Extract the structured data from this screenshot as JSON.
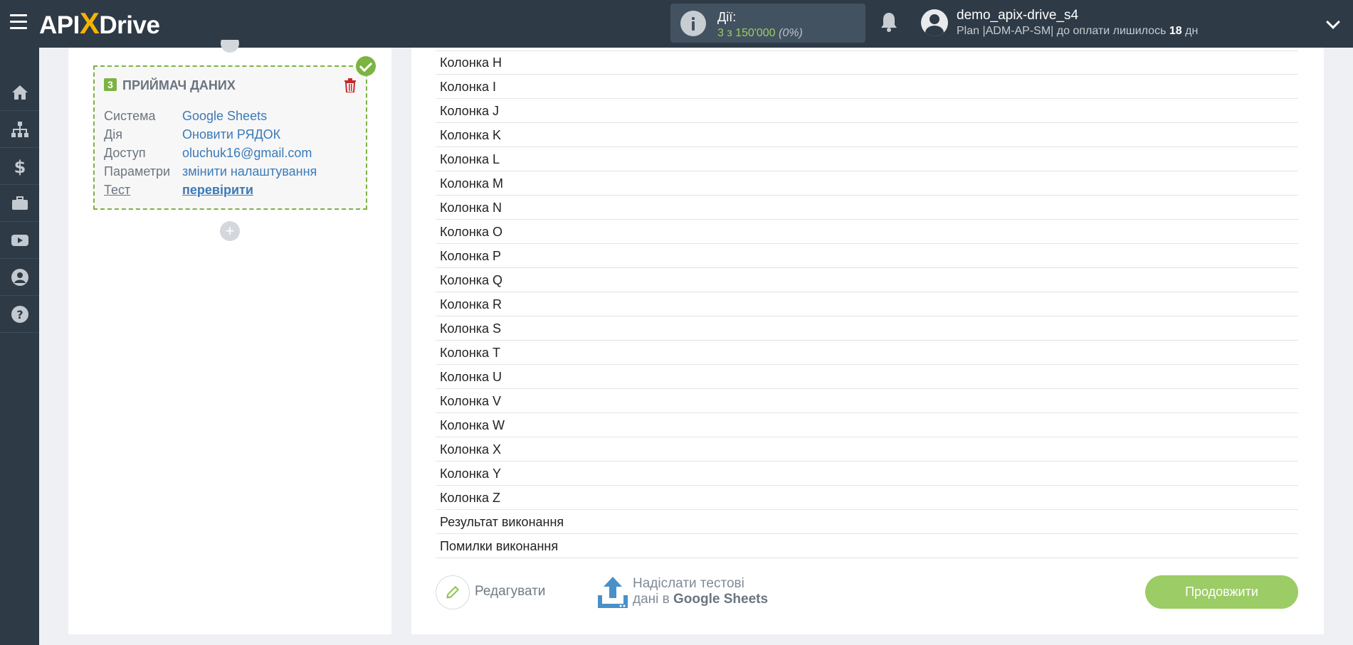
{
  "header": {
    "logo": {
      "prefix": "API",
      "x": "X",
      "suffix": "Drive"
    },
    "actions_label": "Дії:",
    "actions_count": "3 з 150'000",
    "actions_percent": "(0%)",
    "user_name": "demo_apix-drive_s4",
    "plan_text": "Plan |ADM-AP-SM| до оплати лишилось",
    "plan_days": "18",
    "plan_unit": "дн"
  },
  "sidebar": {
    "items": [
      "home-icon",
      "sitemap-icon",
      "dollar-icon",
      "briefcase-icon",
      "youtube-icon",
      "user-icon",
      "help-icon"
    ]
  },
  "card": {
    "step": "3",
    "title": "ПРИЙМАЧ ДАНИХ",
    "rows": [
      {
        "label": "Система",
        "value": "Google Sheets"
      },
      {
        "label": "Дія",
        "value": "Оновити РЯДОК"
      },
      {
        "label": "Доступ",
        "value": "oluchuk16@gmail.com"
      },
      {
        "label": "Параметри",
        "value": "змінити налаштування"
      },
      {
        "label": "Тест",
        "value": "перевірити"
      }
    ],
    "add_symbol": "+"
  },
  "columns": [
    "Колонка H",
    "Колонка I",
    "Колонка J",
    "Колонка K",
    "Колонка L",
    "Колонка M",
    "Колонка N",
    "Колонка O",
    "Колонка P",
    "Колонка Q",
    "Колонка R",
    "Колонка S",
    "Колонка T",
    "Колонка U",
    "Колонка V",
    "Колонка W",
    "Колонка X",
    "Колонка Y",
    "Колонка Z",
    "Результат виконання",
    "Помилки виконання"
  ],
  "footer": {
    "edit_label": "Редагувати",
    "send_line1": "Надіслати тестові",
    "send_line2_prefix": "дані в",
    "send_line2_target": "Google Sheets",
    "continue_label": "Продовжити"
  },
  "colors": {
    "topbar": "#2e3a46",
    "accent_green": "#9ccc65",
    "link_blue": "#3b7ab8"
  }
}
